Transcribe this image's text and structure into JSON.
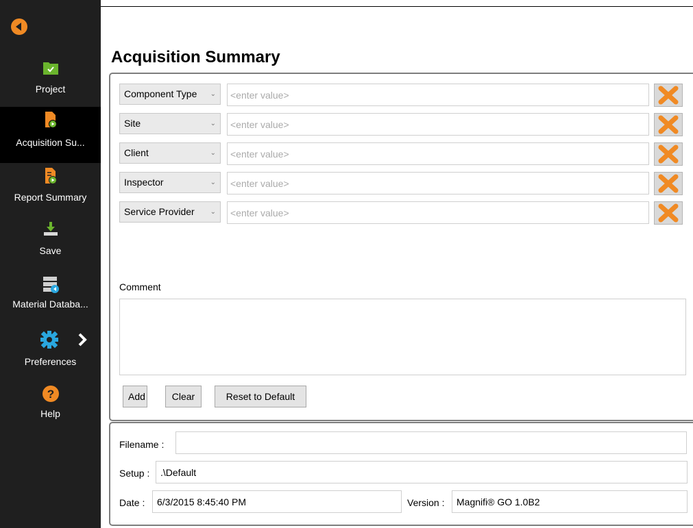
{
  "sidebar": {
    "back_icon": "back-arrow-icon",
    "items": [
      {
        "label": "Project",
        "icon": "folder-check-icon"
      },
      {
        "label": "Acquisition Su...",
        "icon": "document-play-icon",
        "active": true
      },
      {
        "label": "Report Summary",
        "icon": "report-play-icon"
      },
      {
        "label": "Save",
        "icon": "save-download-icon"
      },
      {
        "label": "Material Databa...",
        "icon": "database-icon"
      },
      {
        "label": "Preferences",
        "icon": "gear-icon"
      },
      {
        "label": "Help",
        "icon": "help-icon"
      }
    ],
    "accent_color": "#f08a24",
    "gear_color": "#2aa7df"
  },
  "page": {
    "title": "Acquisition Summary"
  },
  "fields": [
    {
      "type": "Component Type",
      "placeholder": "<enter value>",
      "value": ""
    },
    {
      "type": "Site",
      "placeholder": "<enter value>",
      "value": ""
    },
    {
      "type": "Client",
      "placeholder": "<enter value>",
      "value": ""
    },
    {
      "type": "Inspector",
      "placeholder": "<enter value>",
      "value": ""
    },
    {
      "type": "Service Provider",
      "placeholder": "<enter value>",
      "value": ""
    }
  ],
  "comment": {
    "label": "Comment",
    "value": ""
  },
  "buttons": {
    "add": "Add",
    "clear": "Clear",
    "reset": "Reset to Default"
  },
  "info": {
    "filename_label": "Filename :",
    "filename_value": "",
    "setup_label": "Setup :",
    "setup_value": ".\\Default",
    "date_label": "Date :",
    "date_value": "6/3/2015 8:45:40 PM",
    "version_label": "Version :",
    "version_value": "Magnifi® GO 1.0B2"
  }
}
